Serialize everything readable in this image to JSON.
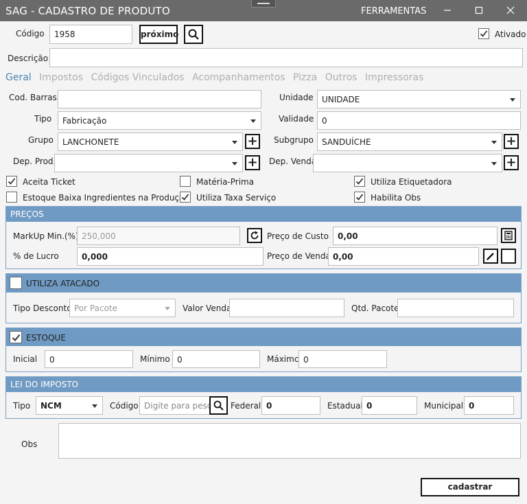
{
  "window": {
    "title": "SAG - CADASTRO DE PRODUTO",
    "menu": "FERRAMENTAS"
  },
  "header": {
    "codigo_label": "Código",
    "codigo_value": "1958",
    "proximo_label": "próximo",
    "ativado_label": "Ativado",
    "ativado_checked": true,
    "descricao_label": "Descrição",
    "descricao_value": ""
  },
  "tabs": [
    "Geral",
    "Impostos",
    "Códigos Vinculados",
    "Acompanhamentos",
    "Pizza",
    "Outros",
    "Impressoras"
  ],
  "geral": {
    "cod_barras_label": "Cod. Barras",
    "cod_barras_value": "",
    "unidade_label": "Unidade",
    "unidade_value": "UNIDADE",
    "tipo_label": "Tipo",
    "tipo_value": "Fabricação",
    "validade_label": "Validade",
    "validade_value": "0",
    "grupo_label": "Grupo",
    "grupo_value": "LANCHONETE",
    "subgrupo_label": "Subgrupo",
    "subgrupo_value": "SANDUÍCHE",
    "dep_prod_label": "Dep. Prod.",
    "dep_prod_value": "",
    "dep_venda_label": "Dep. Venda",
    "dep_venda_value": ""
  },
  "checks": {
    "aceita_ticket": {
      "label": "Aceita Ticket",
      "checked": true
    },
    "materia_prima": {
      "label": "Matéria-Prima",
      "checked": false
    },
    "utiliza_etiquetadora": {
      "label": "Utiliza Etiquetadora",
      "checked": true
    },
    "estoque_baixa": {
      "label": "Estoque Baixa Ingredientes na Produção",
      "checked": false
    },
    "taxa_servico": {
      "label": "Utiliza Taxa Serviço",
      "checked": true
    },
    "habilita_obs": {
      "label": "Habilita Obs",
      "checked": true
    }
  },
  "precos": {
    "title": "PREÇOS",
    "markup_label": "MarkUp Min.(%)",
    "markup_value": "250,000",
    "custo_label": "Preço de Custo",
    "custo_value": "0,00",
    "lucro_label": "% de Lucro",
    "lucro_value": "0,000",
    "venda_label": "Preço de Venda",
    "venda_value": "0,00"
  },
  "atacado": {
    "title": "UTILIZA ATACADO",
    "checked": false,
    "tipo_desc_label": "Tipo Desconto",
    "tipo_desc_value": "Por Pacote",
    "valor_venda_label": "Valor Venda",
    "valor_venda_value": "",
    "qtd_pacote_label": "Qtd. Pacote",
    "qtd_pacote_value": ""
  },
  "estoque": {
    "title": "ESTOQUE",
    "checked": true,
    "inicial_label": "Inicial",
    "inicial_value": "0",
    "minimo_label": "Mínimo",
    "minimo_value": "0",
    "maximo_label": "Máximc",
    "maximo_value": "0"
  },
  "imposto": {
    "title": "LEI DO IMPOSTO",
    "tipo_label": "Tipo",
    "tipo_value": "NCM",
    "codigo_label": "Código",
    "codigo_placeholder": "Digite para pesq",
    "federal_label": "Federal",
    "federal_value": "0",
    "estadual_label": "Estadual",
    "estadual_value": "0",
    "municipal_label": "Municipal",
    "municipal_value": "0"
  },
  "obs": {
    "label": "Obs",
    "value": ""
  },
  "footer": {
    "cadastrar_label": "cadastrar"
  },
  "colors": {
    "titlebar": "#6a6a6a",
    "panel_header": "#6f9ac3",
    "tab_active": "#4a83b3"
  }
}
